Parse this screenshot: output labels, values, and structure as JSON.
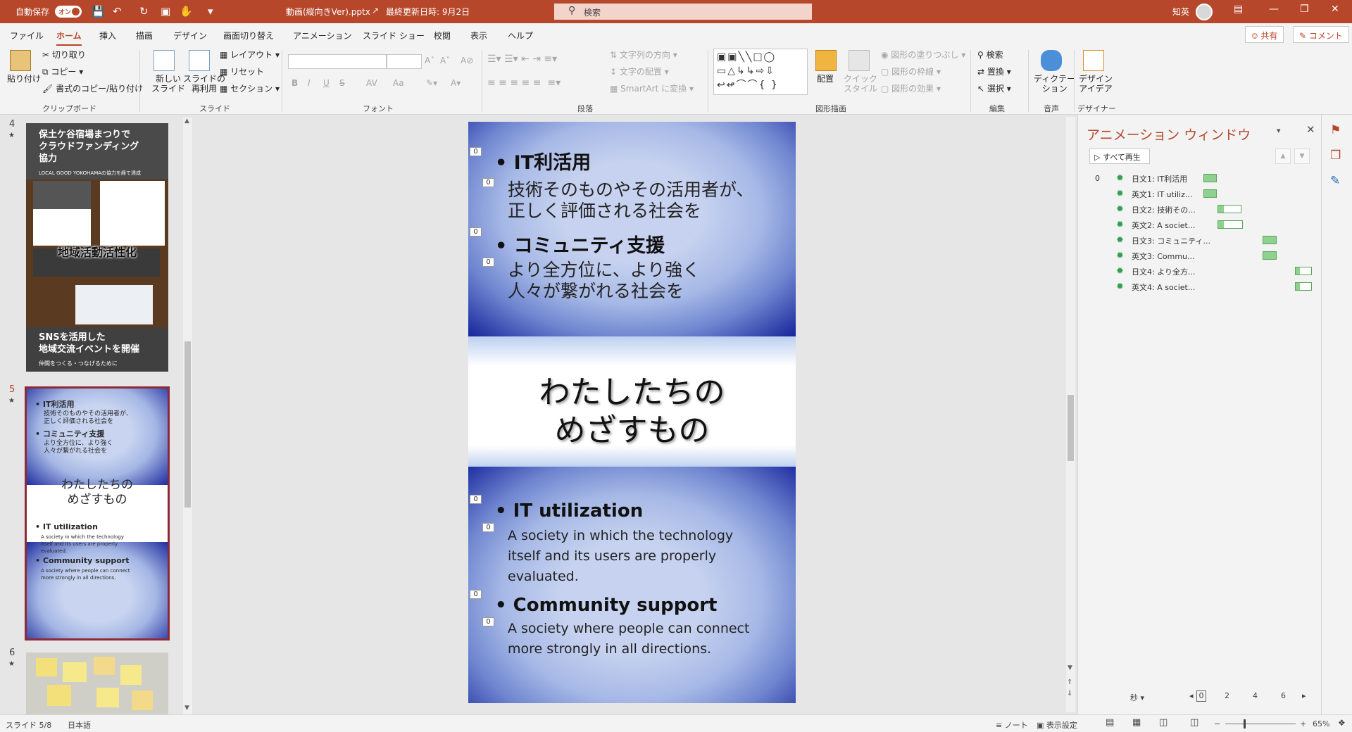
{
  "titlebar": {
    "autosave_label": "自動保存",
    "autosave_state": "オン",
    "document_title": "動画(縦向きVer).pptx",
    "last_saved": "最終更新日時: 9月2日",
    "search_placeholder": "検索",
    "user_name": "知英"
  },
  "menu": {
    "tabs": [
      "ファイル",
      "ホーム",
      "挿入",
      "描画",
      "デザイン",
      "画面切り替え",
      "アニメーション",
      "スライド ショー",
      "校閲",
      "表示",
      "ヘルプ"
    ],
    "active_tab": "ホーム",
    "share_label": "共有",
    "comment_label": "コメント"
  },
  "ribbon": {
    "clipboard": {
      "paste": "貼り付け",
      "cut": "切り取り",
      "copy": "コピー",
      "format_painter": "書式のコピー/貼り付け",
      "group": "クリップボード"
    },
    "slides": {
      "new_slide": "新しい\nスライド",
      "reuse": "スライドの\n再利用",
      "layout": "レイアウト",
      "reset": "リセット",
      "section": "セクション",
      "group": "スライド"
    },
    "font": {
      "group": "フォント",
      "bold": "B",
      "italic": "I",
      "underline": "U",
      "strike": "S",
      "spacing": "AV",
      "case": "Aa"
    },
    "paragraph": {
      "text_direction": "文字列の方向",
      "align_text": "文字の配置",
      "smartart": "SmartArt に変換",
      "group": "段落"
    },
    "drawing": {
      "arrange": "配置",
      "quick_styles": "クイック\nスタイル",
      "fill": "図形の塗りつぶし",
      "outline": "図形の枠線",
      "effects": "図形の効果",
      "group": "図形描画"
    },
    "editing": {
      "find": "検索",
      "replace": "置換",
      "select": "選択",
      "group": "編集"
    },
    "voice": {
      "dictate": "ディクテー\nション",
      "group": "音声"
    },
    "designer": {
      "ideas": "デザイン\nアイデア",
      "group": "デザイナー"
    }
  },
  "thumbnails": [
    {
      "number": "4",
      "mark": "★",
      "title": "保土ケ谷宿場まつりで\nクラウドファンディング\n協力",
      "subtitle": "LOCAL GOOD YOKOHAMAの協力を経て達成",
      "caption": "地域活動活性化",
      "bottom_title": "SNSを活用した\n地域交流イベントを開催",
      "bottom_sub": "仲間をつくる・つなげるために"
    },
    {
      "number": "5",
      "mark": "★",
      "selected": true
    },
    {
      "number": "6",
      "mark": "★"
    }
  ],
  "slide": {
    "jp_items": [
      {
        "heading": "IT利活用",
        "body": "技術そのものやその活用者が、\n正しく評価される社会を"
      },
      {
        "heading": "コミュニティ支援",
        "body": "より全方位に、より強く\n人々が繋がれる社会を"
      }
    ],
    "center_title": "わたしたちの\nめざすもの",
    "en_items": [
      {
        "heading": "IT utilization",
        "body": "A society in which the technology\nitself and its users are properly\nevaluated."
      },
      {
        "heading": "Community support",
        "body": "A society where people can connect\nmore strongly in all directions."
      }
    ],
    "anim_counter": "0"
  },
  "animation_pane": {
    "title": "アニメーション ウィンドウ",
    "play_all": "すべて再生",
    "group_index": "0",
    "items": [
      {
        "label": "日文1: IT利活用"
      },
      {
        "label": "英文1: IT utiliz..."
      },
      {
        "label": "日文2: 技術その..."
      },
      {
        "label": "英文2: A societ..."
      },
      {
        "label": "日文3: コミュニティ..."
      },
      {
        "label": "英文3: Commu..."
      },
      {
        "label": "日文4: より全方..."
      },
      {
        "label": "英文4: A societ..."
      }
    ],
    "seconds_label": "秒",
    "timeline_ticks": [
      "0",
      "2",
      "4",
      "6"
    ]
  },
  "status": {
    "slide_pos": "スライド 5/8",
    "language": "日本語",
    "notes": "ノート",
    "display_settings": "表示設定",
    "zoom": "65%"
  },
  "colors": {
    "accent": "#b7472a",
    "slide_blue": "#1b2a9e",
    "anim_green": "#8fd18f"
  }
}
